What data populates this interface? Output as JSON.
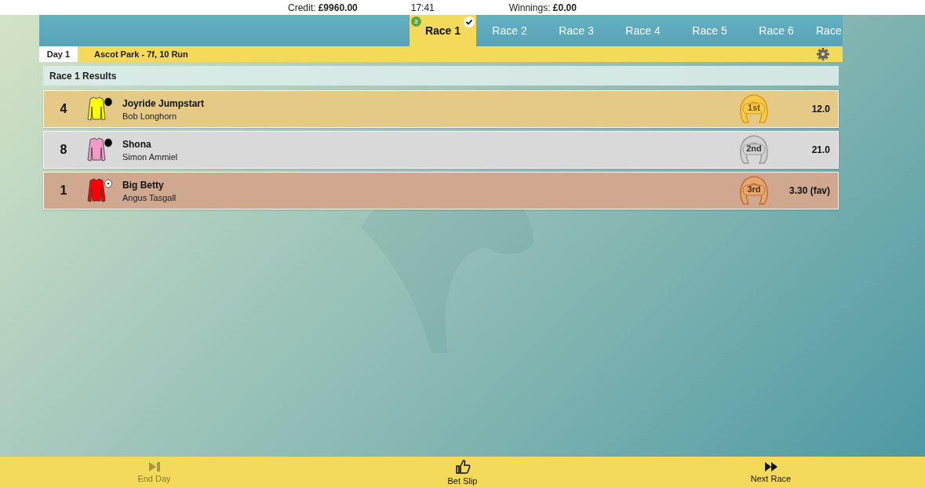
{
  "top_bar": {
    "credit_label": "Credit:",
    "credit": "£9960.00",
    "time": "17:41",
    "winnings_label": "Winnings:",
    "winnings": "£0.00"
  },
  "tabs": [
    {
      "label": "Race 1",
      "selected": true,
      "badge": "2",
      "done": true
    },
    {
      "label": "Race 2",
      "selected": false,
      "done": false
    },
    {
      "label": "Race 3",
      "selected": false,
      "done": false
    },
    {
      "label": "Race 4",
      "selected": false,
      "done": false
    },
    {
      "label": "Race 5",
      "selected": false,
      "done": false
    },
    {
      "label": "Race 6",
      "selected": false,
      "done": false
    },
    {
      "label": "Race",
      "selected": false,
      "done": false
    }
  ],
  "info_bar": {
    "day": "Day 1",
    "meeting": "Ascot Park - 7f, 10 Run"
  },
  "results": {
    "title": "Race 1 Results",
    "rows": [
      {
        "number": "4",
        "horse": "Joyride Jumpstart",
        "jockey": "Bob Longhorn",
        "color": "#e5c987",
        "silks": {
          "color": "#ffff00"
        },
        "cap": {
          "color": "#000000"
        },
        "place": "1st",
        "kind": "gold",
        "odds": "12.0"
      },
      {
        "number": "8",
        "horse": "Shona",
        "jockey": "Simon Ammiel",
        "color": "#d9d9d9",
        "silks": {
          "color": "#f39ac8"
        },
        "cap": {
          "color": "#000000"
        },
        "place": "2nd",
        "kind": "silver",
        "odds": "21.0"
      },
      {
        "number": "1",
        "horse": "Big Betty",
        "jockey": "Angus Tasgall",
        "color": "#d0a890",
        "silks": {
          "color": "#ff0000"
        },
        "cap": {
          "color": "#ffffff"
        },
        "place": "3rd",
        "kind": "bronze",
        "odds": "3.30 (fav)"
      }
    ]
  },
  "footer": [
    {
      "kind": "end",
      "label": "End Day",
      "disabled": true
    },
    {
      "kind": "slip",
      "label": "Bet Slip",
      "disabled": false
    },
    {
      "kind": "next",
      "label": "Next Race",
      "disabled": false
    }
  ]
}
